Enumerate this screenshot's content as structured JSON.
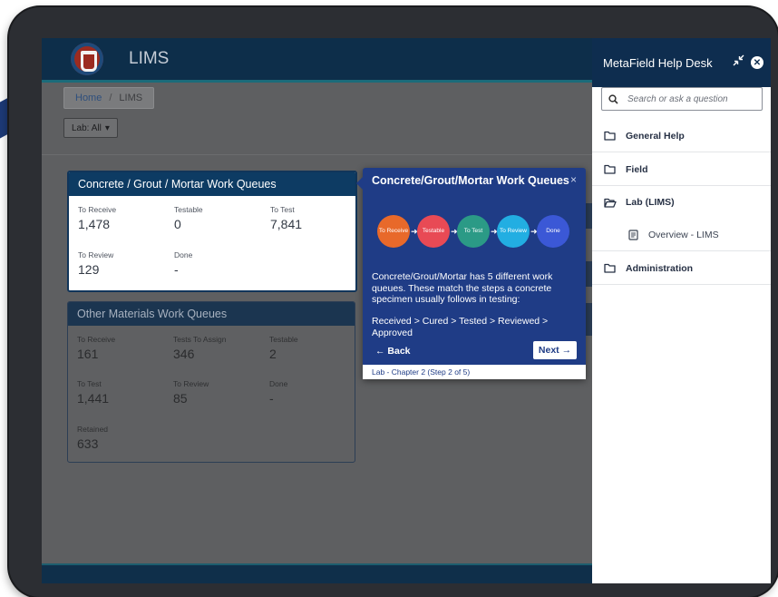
{
  "app": {
    "title": "LIMS"
  },
  "breadcrumb": {
    "home": "Home",
    "separator": "/",
    "current": "LIMS"
  },
  "filter": {
    "label": "Lab: All",
    "caret": "▾"
  },
  "concrete_card": {
    "title": "Concrete / Grout / Mortar Work Queues",
    "stats": [
      {
        "label": "To Receive",
        "value": "1,478"
      },
      {
        "label": "Testable",
        "value": "0"
      },
      {
        "label": "To Test",
        "value": "7,841"
      },
      {
        "label": "To Review",
        "value": "129"
      },
      {
        "label": "Done",
        "value": "-"
      }
    ]
  },
  "other_card": {
    "title": "Other Materials Work Queues",
    "stats": [
      {
        "label": "To Receive",
        "value": "161"
      },
      {
        "label": "Tests To Assign",
        "value": "346"
      },
      {
        "label": "Testable",
        "value": "2"
      },
      {
        "label": "To Test",
        "value": "1,441"
      },
      {
        "label": "To Review",
        "value": "85"
      },
      {
        "label": "Done",
        "value": "-"
      },
      {
        "label": "Retained",
        "value": "633"
      }
    ]
  },
  "tour": {
    "title": "Concrete/Grout/Mortar Work Queues",
    "close": "×",
    "flow_steps": [
      {
        "label": "To Receive",
        "color": "#e8692a"
      },
      {
        "label": "Testable",
        "color": "#e84a55"
      },
      {
        "label": "To Test",
        "color": "#2b9a86"
      },
      {
        "label": "To Review",
        "color": "#22aee2"
      },
      {
        "label": "Done",
        "color": "#3b58d6"
      }
    ],
    "description": "Concrete/Grout/Mortar has 5 different work queues. These match the steps a concrete specimen usually follows in testing:",
    "path": "Received > Cured > Tested > Reviewed > Approved",
    "back": "← Back",
    "next": "Next →",
    "footer": "Lab - Chapter 2 (Step 2 of 5)"
  },
  "helpdesk": {
    "title": "MetaField Help Desk",
    "search_placeholder": "Search or ask a question",
    "items": [
      {
        "label": "General Help"
      },
      {
        "label": "Field"
      },
      {
        "label": "Lab (LIMS)"
      },
      {
        "label": "Overview - LIMS"
      },
      {
        "label": "Administration"
      }
    ]
  },
  "colors": {
    "header": "#0d2e4a",
    "popover": "#1f3c86",
    "helpdesk_header": "#0e2d4f"
  },
  "icons": {
    "logo": "lims-logo",
    "search": "search-icon",
    "folder": "folder-icon",
    "folder_open": "folder-open-icon",
    "document": "document-icon",
    "collapse": "collapse-icon",
    "close": "close-icon"
  }
}
